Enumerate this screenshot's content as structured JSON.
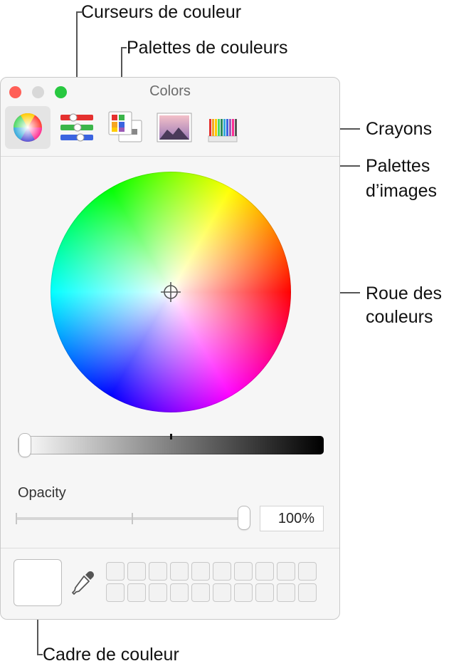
{
  "callouts": {
    "sliders": "Curseurs de couleur",
    "palettes": "Palettes de couleurs",
    "crayons": "Crayons",
    "image_palettes_line1": "Palettes",
    "image_palettes_line2": "d’images",
    "wheel_line1": "Roue des",
    "wheel_line2": "couleurs",
    "color_box": "Cadre de couleur"
  },
  "window": {
    "title": "Colors",
    "traffic_lights": [
      "#ff5f57",
      "#d8d8d8",
      "#28c840"
    ]
  },
  "toolbar": {
    "items": [
      {
        "name": "color-wheel-tab",
        "icon": "color-wheel-icon",
        "selected": true
      },
      {
        "name": "color-sliders-tab",
        "icon": "sliders-icon",
        "selected": false
      },
      {
        "name": "color-palettes-tab",
        "icon": "palettes-icon",
        "selected": false
      },
      {
        "name": "image-palettes-tab",
        "icon": "image-icon",
        "selected": false
      },
      {
        "name": "crayons-tab",
        "icon": "crayons-icon",
        "selected": false
      }
    ]
  },
  "brightness": {
    "value": 1.0
  },
  "opacity": {
    "label": "Opacity",
    "value_text": "100%",
    "value": 1.0
  },
  "swatches": {
    "rows": 2,
    "columns": 10
  }
}
